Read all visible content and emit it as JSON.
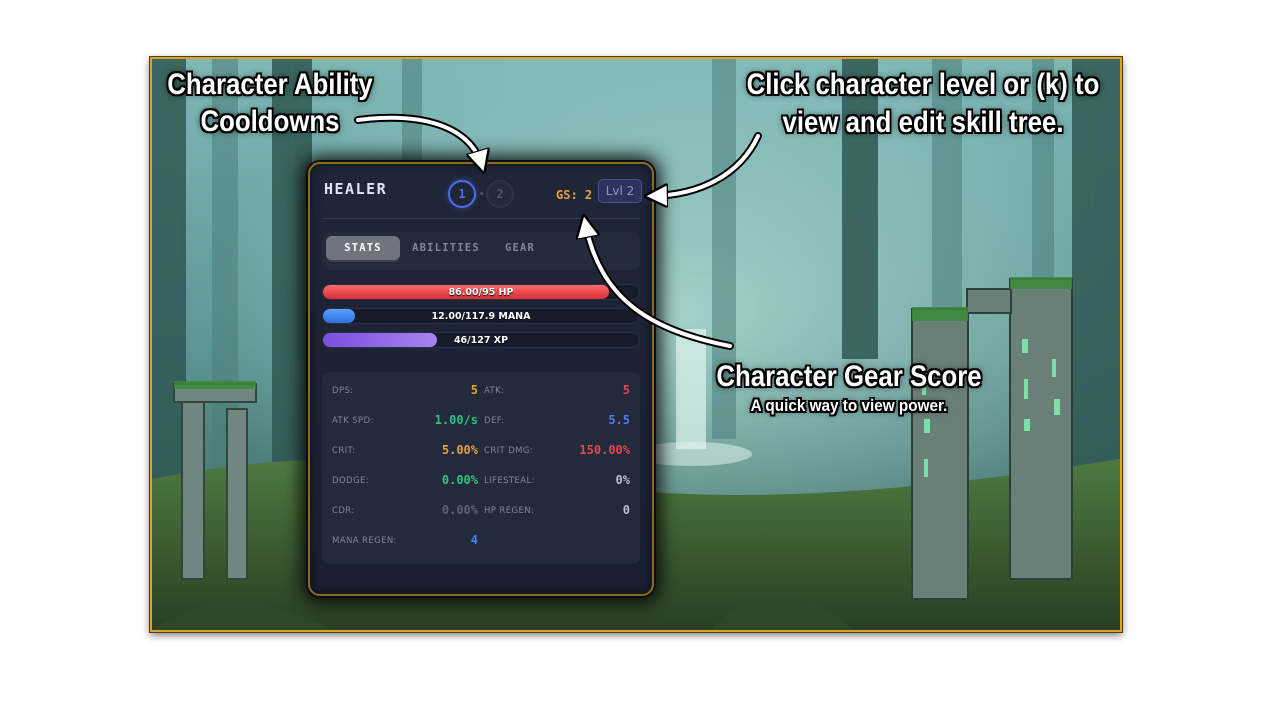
{
  "annotations": {
    "cooldowns": [
      "Character Ability",
      "Cooldowns"
    ],
    "skill_tree": [
      "Click character level or (k) to",
      "view and edit skill tree."
    ],
    "gear_score": "Character Gear Score",
    "gear_score_sub": "A quick way to view power."
  },
  "panel": {
    "title": "HEALER",
    "cooldowns": [
      "1",
      "2"
    ],
    "gear_score": "GS: 2",
    "level": "Lvl 2",
    "tabs": [
      "STATS",
      "ABILITIES",
      "GEAR"
    ],
    "active_tab": "STATS",
    "bars": {
      "hp": {
        "text": "86.00/95 HP",
        "fill_fraction": 0.905,
        "color": "#e0383c"
      },
      "mana": {
        "text": "12.00/117.9 MANA",
        "fill_fraction": 0.102,
        "color": "#3d82f0"
      },
      "xp": {
        "text": "46/127 XP",
        "fill_fraction": 0.362,
        "color": "#9a6ef0"
      }
    },
    "stats": [
      {
        "label": "DPS:",
        "value": "5",
        "color": "#e8a236"
      },
      {
        "label": "ATK:",
        "value": "5",
        "color": "#e4474a"
      },
      {
        "label": "ATK SPD:",
        "value": "1.00/s",
        "color": "#2ec27e"
      },
      {
        "label": "DEF:",
        "value": "5.5",
        "color": "#4b7ff0"
      },
      {
        "label": "CRIT:",
        "value": "5.00%",
        "color": "#e8a236"
      },
      {
        "label": "CRIT DMG:",
        "value": "150.00%",
        "color": "#e4474a"
      },
      {
        "label": "DODGE:",
        "value": "0.00%",
        "color": "#2ec27e"
      },
      {
        "label": "LIFESTEAL:",
        "value": "0%",
        "color": "#b8bfd0"
      },
      {
        "label": "CDR:",
        "value": "0.00%",
        "color": "#5a6278"
      },
      {
        "label": "HP REGEN:",
        "value": "0",
        "color": "#b8bfd0"
      },
      {
        "label": "MANA REGEN:",
        "value": "4",
        "color": "#4b7ff0"
      }
    ]
  },
  "colors": {
    "frame": "#d8a42a",
    "panel_border": "#8c6a1e",
    "accent_blue": "#4b6ef0"
  }
}
